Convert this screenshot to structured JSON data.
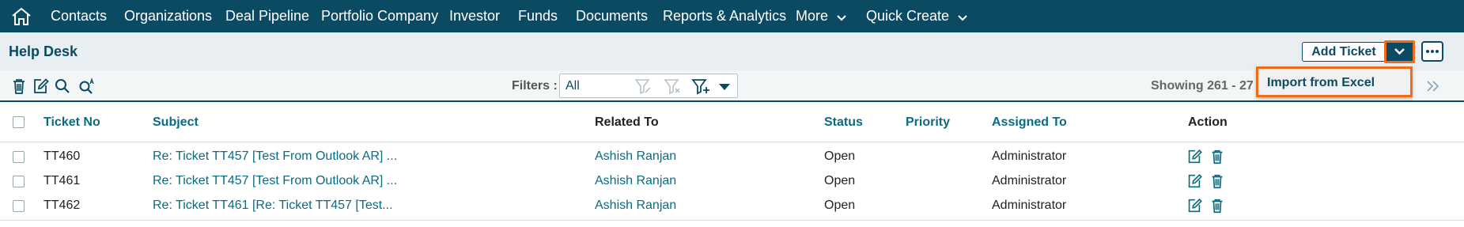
{
  "nav": {
    "items": [
      {
        "label": "Contacts"
      },
      {
        "label": "Organizations"
      },
      {
        "label": "Deal Pipeline"
      },
      {
        "label": "Portfolio Company"
      },
      {
        "label": "Investor"
      },
      {
        "label": "Funds"
      },
      {
        "label": "Documents"
      },
      {
        "label": "Reports & Analytics"
      },
      {
        "label": "More"
      },
      {
        "label": "Quick Create"
      }
    ]
  },
  "header": {
    "title": "Help Desk",
    "add_button": "Add Ticket",
    "dropdown_item": "Import from Excel"
  },
  "toolbar": {
    "filter_label": "Filters :",
    "filter_value": "All",
    "showing": "Showing 261 - 27"
  },
  "table": {
    "columns": {
      "ticket_no": "Ticket No",
      "subject": "Subject",
      "related_to": "Related To",
      "status": "Status",
      "priority": "Priority",
      "assigned_to": "Assigned To",
      "action": "Action"
    },
    "rows": [
      {
        "ticket_no": "TT460",
        "subject": "Re: Ticket TT457 [Test From Outlook AR] ...",
        "related_to": "Ashish Ranjan",
        "status": "Open",
        "priority": "",
        "assigned_to": "Administrator"
      },
      {
        "ticket_no": "TT461",
        "subject": "Re: Ticket TT457 [Test From Outlook AR] ...",
        "related_to": "Ashish Ranjan",
        "status": "Open",
        "priority": "",
        "assigned_to": "Administrator"
      },
      {
        "ticket_no": "TT462",
        "subject": "Re: Ticket TT461 [Re: Ticket TT457 [Test...",
        "related_to": "Ashish Ranjan",
        "status": "Open",
        "priority": "",
        "assigned_to": "Administrator"
      }
    ]
  },
  "colors": {
    "brand": "#0b4a63",
    "link": "#0b6b80",
    "highlight": "#ef6c1a"
  }
}
